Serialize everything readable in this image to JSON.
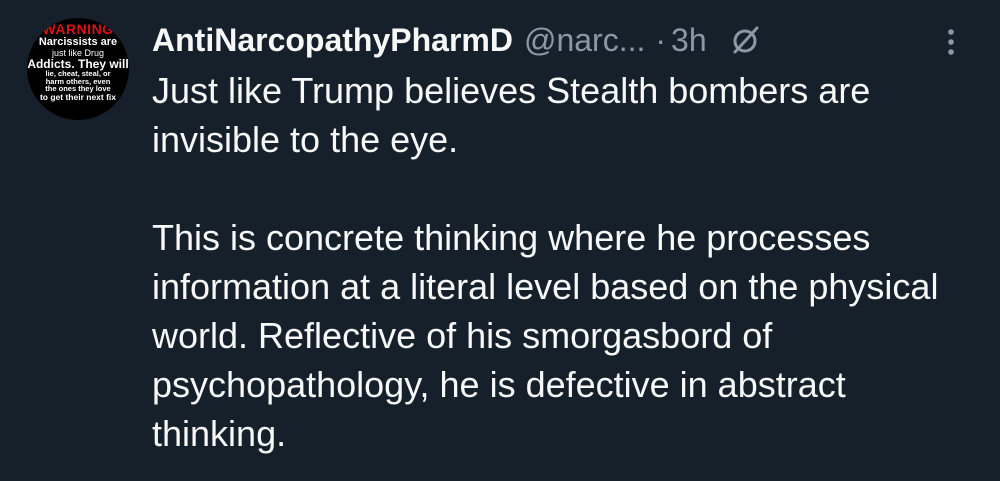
{
  "tweet": {
    "avatar": {
      "lines": [
        "WARNING",
        "Narcissists are",
        "just like Drug",
        "Addicts. They will",
        "lie, cheat, steal, or",
        "harm others, even",
        "the ones they love",
        "to get their next fix",
        "",
        ""
      ]
    },
    "display_name": "AntiNarcopathyPharmD",
    "handle": "@narc...",
    "separator": "·",
    "timestamp": "3h",
    "icons": {
      "grok": "grok-slash-circle-icon",
      "more": "more-vertical-icon"
    },
    "paragraphs": [
      "Just like Trump believes Stealth bombers are invisible to the eye.",
      "This is concrete thinking where he processes information at a literal level based on the physical world. Reflective of his smorgasbord of psychopathology, he is defective in abstract thinking."
    ]
  },
  "colors": {
    "background": "#15202b",
    "text": "#f7f9f9",
    "secondary_text": "#8b98a5",
    "warning_red": "#dd1111"
  }
}
